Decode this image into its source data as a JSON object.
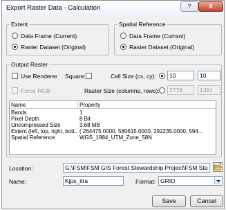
{
  "window": {
    "title": "Export Raster Data - Calculation",
    "help_glyph": "?",
    "close_glyph": "X"
  },
  "extent": {
    "legend": "Extent",
    "options": [
      {
        "label": "Data Frame (Current)",
        "selected": false
      },
      {
        "label": "Raster Dataset (Original)",
        "selected": true
      }
    ]
  },
  "spatial_reference": {
    "legend": "Spatial Reference",
    "options": [
      {
        "label": "Data Frame (Current)",
        "selected": false
      },
      {
        "label": "Raster Dataset (Original)",
        "selected": true
      }
    ]
  },
  "output_raster": {
    "legend": "Output Raster",
    "use_renderer_label": "Use Renderer",
    "use_renderer_checked": false,
    "square_label": "Square:",
    "square_checked": false,
    "cell_size_label": "Cell Size (cx, cy):",
    "cell_size_selected": true,
    "cell_size_x": "10",
    "cell_size_y": "10",
    "force_rgb_label": "Force RGB",
    "force_rgb_enabled": false,
    "raster_size_label": "Raster Size (columns, rows):",
    "raster_size_selected": false,
    "raster_columns": "2776",
    "raster_rows": "1391"
  },
  "properties_table": {
    "headers": [
      "Name",
      "Property"
    ],
    "rows": [
      {
        "name": "Bands",
        "value": "1"
      },
      {
        "name": "Pixel Depth",
        "value": "8 Bit"
      },
      {
        "name": "Uncompressed Size",
        "value": "3.68 MB"
      },
      {
        "name": "Extent (left, top, right, bott...",
        "value": "( 264475.0000, 580615.0000, 292235.0000, 594..."
      },
      {
        "name": "Spatial Reference",
        "value": "WGS_1984_UTM_Zone_58N"
      }
    ]
  },
  "location": {
    "label": "Location:",
    "value": "G:\\FSM\\FSM GIS Forest Stewardship Project\\FSM Sta",
    "browse_icon": "open-folder-icon"
  },
  "name_field": {
    "label": "Name:",
    "value": "Kjps_itra"
  },
  "format": {
    "label": "Format:",
    "selected": "GRID"
  },
  "buttons": {
    "save": "Save",
    "cancel": "Cancel"
  },
  "colors": {
    "dialog_bg": "#f0f0f0",
    "field_border": "#7f9db9",
    "close_button": "#c0452c"
  }
}
